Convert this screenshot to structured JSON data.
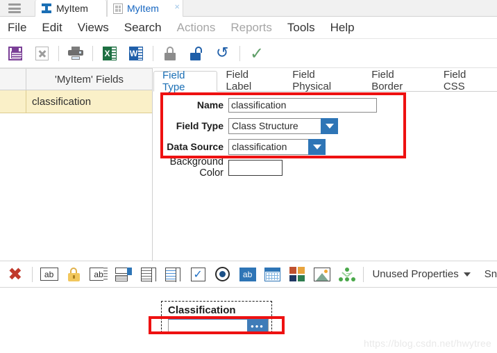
{
  "window": {
    "menu_icon": "hamburger-icon",
    "tabs": [
      {
        "label": "MyItem",
        "icon": "ibeam-icon",
        "active": false
      },
      {
        "label": "MyItem",
        "icon": "grid-document-icon",
        "active": true,
        "close": "×"
      }
    ]
  },
  "menubar": {
    "items": [
      {
        "label": "File",
        "dim": false
      },
      {
        "label": "Edit",
        "dim": false
      },
      {
        "label": "Views",
        "dim": false
      },
      {
        "label": "Search",
        "dim": false
      },
      {
        "label": "Actions",
        "dim": true
      },
      {
        "label": "Reports",
        "dim": true
      },
      {
        "label": "Tools",
        "dim": false
      },
      {
        "label": "Help",
        "dim": false
      }
    ]
  },
  "toolbar": {
    "buttons": [
      {
        "name": "save-icon",
        "title": "Save"
      },
      {
        "name": "delete-icon",
        "title": "Delete"
      },
      {
        "name": "print-icon",
        "title": "Print"
      },
      {
        "name": "export-excel-icon",
        "title": "Export to Excel",
        "letter": "X"
      },
      {
        "name": "export-word-icon",
        "title": "Export to Word",
        "letter": "W"
      },
      {
        "name": "lock-closed-icon",
        "title": "Lock"
      },
      {
        "name": "lock-open-icon",
        "title": "Unlock"
      },
      {
        "name": "undo-icon",
        "title": "Undo",
        "glyph": "↺"
      },
      {
        "name": "confirm-check-icon",
        "title": "Apply",
        "glyph": "✓"
      }
    ]
  },
  "fields_grid": {
    "header": "'MyItem' Fields",
    "rows": [
      {
        "name": "classification"
      }
    ]
  },
  "field_tabs": [
    {
      "label": "Field Type",
      "active": true
    },
    {
      "label": "Field Label",
      "active": false
    },
    {
      "label": "Field Physical",
      "active": false
    },
    {
      "label": "Field Border",
      "active": false
    },
    {
      "label": "Field CSS",
      "active": false
    }
  ],
  "form": {
    "name_label": "Name",
    "name_value": "classification",
    "field_type_label": "Field Type",
    "field_type_value": "Class Structure",
    "data_source_label": "Data Source",
    "data_source_value": "classification",
    "background_color_label": "Background Color",
    "background_color_value": ""
  },
  "bottom_toolbar": {
    "buttons": [
      {
        "name": "remove-red-x-icon",
        "title": "Remove"
      },
      {
        "name": "text-field-icon",
        "title": "Text Field",
        "text": "ab"
      },
      {
        "name": "locked-field-icon",
        "title": "Locked Field"
      },
      {
        "name": "text-area-icon",
        "title": "Text Area",
        "text": "ab"
      },
      {
        "name": "combo-box-icon",
        "title": "Combo Box"
      },
      {
        "name": "list-box-icon",
        "title": "List Box"
      },
      {
        "name": "multi-select-list-icon",
        "title": "Multi-Select List"
      },
      {
        "name": "checkbox-icon",
        "title": "Checkbox",
        "glyph": "✓"
      },
      {
        "name": "radio-button-icon",
        "title": "Radio Button"
      },
      {
        "name": "label-icon",
        "title": "Label",
        "text": "ab"
      },
      {
        "name": "date-picker-icon",
        "title": "Date Picker"
      },
      {
        "name": "color-picker-icon",
        "title": "Color Picker"
      },
      {
        "name": "image-icon",
        "title": "Image"
      },
      {
        "name": "class-structure-icon",
        "title": "Class Structure"
      }
    ],
    "unused_properties_label": "Unused Properties",
    "snap_label": "Sn"
  },
  "preview": {
    "field_label": "Classification",
    "field_value": "",
    "ellipsis_button": "•••"
  },
  "watermark": "https://blog.csdn.net/hwytree",
  "colors": {
    "accent_blue": "#2e75b6",
    "tab_active_text": "#1565c0",
    "highlight_row": "#faf0c8",
    "red_annotation": "#ee1111",
    "excel_green": "#1d6f42",
    "word_blue": "#1f5fa9",
    "save_purple": "#7a3f96",
    "check_green": "#5f9e68",
    "red_x": "#c0392b",
    "gold_lock": "#f2c75c"
  }
}
